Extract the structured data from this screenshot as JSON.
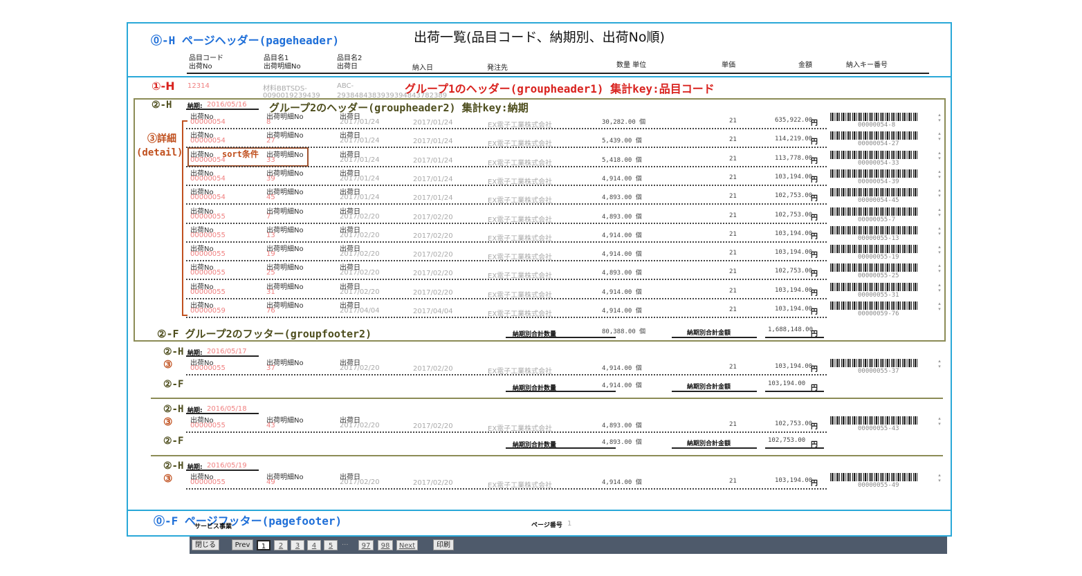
{
  "header": {
    "title": "出荷一覧(品目コード、納期別、出荷No順)",
    "page_header_label": "⓪-H ページヘッダー(pageheader)",
    "columns": [
      {
        "l1": "品目コード",
        "l2": "出荷No"
      },
      {
        "l1": "品目名1",
        "l2": "出荷明細No"
      },
      {
        "l1": "品目名2",
        "l2": "出荷日"
      },
      {
        "l1": "",
        "l2": "納入日"
      },
      {
        "l1": "",
        "l2": "発注先"
      },
      {
        "l1": "",
        "l2": "数量 単位"
      },
      {
        "l1": "",
        "l2": "単価"
      },
      {
        "l1": "",
        "l2": "金額"
      },
      {
        "l1": "",
        "l2": "納入キー番号"
      }
    ]
  },
  "group1": {
    "marker": "①-H",
    "code": "12314",
    "name1": "材料BBTSDS-",
    "name2": "ABC-",
    "sub1": "0090019239439",
    "sub2": "2938484383939394843782389",
    "desc": "グループ1のヘッダー(groupheader1) 集計key:品目コード"
  },
  "labels": {
    "g2h": "②-H",
    "g2f": "②-F",
    "detail_marker": "③",
    "detail_title": "③詳細",
    "detail_sub": "(detail)",
    "g2_desc": "グループ2のヘッダー(groupheader2) 集計key:納期",
    "g2f_desc": "②-F グループ2のフッター(groupfooter2)",
    "sort": "sort条件",
    "due_label": "納期:",
    "ship_no": "出荷No",
    "detail_no": "出荷明細No",
    "ship_date": "出荷日",
    "yen": "円",
    "sum_qty": "納期別合計数量",
    "sum_amt": "納期別合計金額"
  },
  "groups": [
    {
      "due": "2016/05/16",
      "rows": [
        {
          "ship_no": "00000054",
          "detail_no": "8",
          "ship_date": "2017/01/24",
          "delivery": "2017/01/24",
          "vendor": "EX電子工業株式会社",
          "qty": "30,282.00 個",
          "price": "21",
          "amount": "635,922.00",
          "key": "00000054-8"
        },
        {
          "ship_no": "00000054",
          "detail_no": "27",
          "ship_date": "2017/01/24",
          "delivery": "2017/01/24",
          "vendor": "EX電子工業株式会社",
          "qty": "5,439.00 個",
          "price": "21",
          "amount": "114,219.00",
          "key": "00000054-27"
        },
        {
          "ship_no": "00000054",
          "detail_no": "33",
          "ship_date": "2017/01/24",
          "delivery": "2017/01/24",
          "vendor": "EX電子工業株式会社",
          "qty": "5,418.00 個",
          "price": "21",
          "amount": "113,778.00",
          "key": "00000054-33"
        },
        {
          "ship_no": "00000054",
          "detail_no": "39",
          "ship_date": "2017/01/24",
          "delivery": "2017/01/24",
          "vendor": "EX電子工業株式会社",
          "qty": "4,914.00 個",
          "price": "21",
          "amount": "103,194.00",
          "key": "00000054-39"
        },
        {
          "ship_no": "00000054",
          "detail_no": "45",
          "ship_date": "2017/01/24",
          "delivery": "2017/01/24",
          "vendor": "EX電子工業株式会社",
          "qty": "4,893.00 個",
          "price": "21",
          "amount": "102,753.00",
          "key": "00000054-45"
        },
        {
          "ship_no": "00000055",
          "detail_no": "7",
          "ship_date": "2017/02/20",
          "delivery": "2017/02/20",
          "vendor": "EX電子工業株式会社",
          "qty": "4,893.00 個",
          "price": "21",
          "amount": "102,753.00",
          "key": "00000055-7"
        },
        {
          "ship_no": "00000055",
          "detail_no": "13",
          "ship_date": "2017/02/20",
          "delivery": "2017/02/20",
          "vendor": "EX電子工業株式会社",
          "qty": "4,914.00 個",
          "price": "21",
          "amount": "103,194.00",
          "key": "00000055-13"
        },
        {
          "ship_no": "00000055",
          "detail_no": "19",
          "ship_date": "2017/02/20",
          "delivery": "2017/02/20",
          "vendor": "EX電子工業株式会社",
          "qty": "4,914.00 個",
          "price": "21",
          "amount": "103,194.00",
          "key": "00000055-19"
        },
        {
          "ship_no": "00000055",
          "detail_no": "25",
          "ship_date": "2017/02/20",
          "delivery": "2017/02/20",
          "vendor": "EX電子工業株式会社",
          "qty": "4,893.00 個",
          "price": "21",
          "amount": "102,753.00",
          "key": "00000055-25"
        },
        {
          "ship_no": "00000055",
          "detail_no": "31",
          "ship_date": "2017/02/20",
          "delivery": "2017/02/20",
          "vendor": "EX電子工業株式会社",
          "qty": "4,914.00 個",
          "price": "21",
          "amount": "103,194.00",
          "key": "00000055-31"
        },
        {
          "ship_no": "00000059",
          "detail_no": "76",
          "ship_date": "2017/04/04",
          "delivery": "2017/04/04",
          "vendor": "EX電子工業株式会社",
          "qty": "4,914.00 個",
          "price": "21",
          "amount": "103,194.00",
          "key": "00000059-76"
        }
      ],
      "total_qty": "80,388.00 個",
      "total_amt": "1,688,148.00"
    },
    {
      "due": "2016/05/17",
      "rows": [
        {
          "ship_no": "00000055",
          "detail_no": "37",
          "ship_date": "2017/02/20",
          "delivery": "2017/02/20",
          "vendor": "EX電子工業株式会社",
          "qty": "4,914.00 個",
          "price": "21",
          "amount": "103,194.00",
          "key": "00000055-37"
        }
      ],
      "total_qty": "4,914.00 個",
      "total_amt": "103,194.00"
    },
    {
      "due": "2016/05/18",
      "rows": [
        {
          "ship_no": "00000055",
          "detail_no": "43",
          "ship_date": "2017/02/20",
          "delivery": "2017/02/20",
          "vendor": "EX電子工業株式会社",
          "qty": "4,893.00 個",
          "price": "21",
          "amount": "102,753.00",
          "key": "00000055-43"
        }
      ],
      "total_qty": "4,893.00 個",
      "total_amt": "102,753.00"
    },
    {
      "due": "2016/05/19",
      "rows": [
        {
          "ship_no": "00000055",
          "detail_no": "49",
          "ship_date": "2017/02/20",
          "delivery": "2017/02/20",
          "vendor": "EX電子工業株式会社",
          "qty": "4,914.00 個",
          "price": "21",
          "amount": "103,194.00",
          "key": "00000055-49"
        }
      ]
    }
  ],
  "footer": {
    "label": "⓪-F ページフッター(pagefooter)",
    "page_label": "ページ番号",
    "page_num": "1",
    "service": "サービス事業"
  },
  "toolbar": {
    "close": "閉じる",
    "prev": "Prev",
    "pages": [
      "1",
      "2",
      "3",
      "4",
      "5"
    ],
    "ellipsis": "...",
    "far_pages": [
      "97",
      "98"
    ],
    "next": "Next",
    "print": "印刷"
  }
}
